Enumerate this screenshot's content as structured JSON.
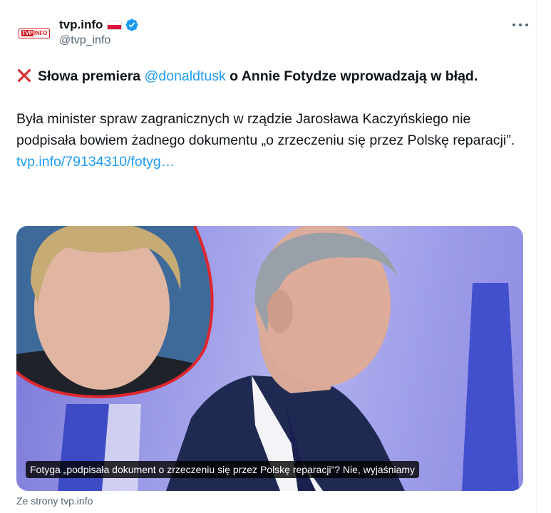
{
  "account": {
    "display_name": "tvp.info",
    "handle": "@tvp_info",
    "avatar_text": "TVP.INFO",
    "flag": "poland-flag",
    "verified": true
  },
  "tweet": {
    "headline_icon": "red-x-icon",
    "headline_pre": "Słowa premiera ",
    "mention": "@donaldtusk",
    "headline_post": " o Annie Fotydze wprowadzają w błąd.",
    "body": "Była minister spraw zagranicznych w rządzie Jarosława Kaczyńskiego nie podpisała bowiem żadnego dokumentu „o zrzeczeniu się przez Polskę reparacji”.",
    "link": "tvp.info/79134310/fotyg…"
  },
  "card": {
    "caption": "Fotyga „podpisała dokument o zrzeczeniu się przez Polskę reparacji”? Nie, wyjaśniamy",
    "source": "Ze strony tvp.info"
  },
  "colors": {
    "link": "#1d9bf0",
    "text": "#0f1419",
    "muted": "#536471",
    "brand_red": "#d71920",
    "card_purple": "#9a99e6"
  }
}
